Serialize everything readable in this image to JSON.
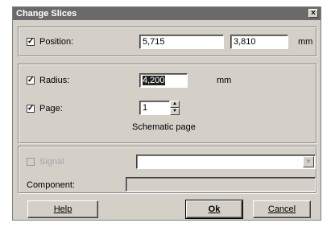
{
  "window": {
    "title": "Change Slices",
    "close_glyph": "×"
  },
  "position": {
    "checked": true,
    "check_glyph": "✓",
    "label": "Position:",
    "x_value": "5,715",
    "y_value": "3,810",
    "unit": "mm"
  },
  "radius": {
    "checked": true,
    "check_glyph": "✓",
    "label": "Radius:",
    "value": "4,200",
    "unit": "mm"
  },
  "page": {
    "checked": true,
    "check_glyph": "✓",
    "label": "Page:",
    "value": "1",
    "sublabel": "Schematic page",
    "up_glyph": "▲",
    "down_glyph": "▼"
  },
  "signal": {
    "checked": false,
    "label": "Signal",
    "value": "",
    "dropdown_glyph": "▼"
  },
  "component": {
    "label": "Component:",
    "value": ""
  },
  "buttons": {
    "help": "Help",
    "ok": "Ok",
    "cancel": "Cancel"
  },
  "colors": {
    "dialog_bg": "#d4d0c8",
    "titlebar": "#6a6a6a"
  }
}
